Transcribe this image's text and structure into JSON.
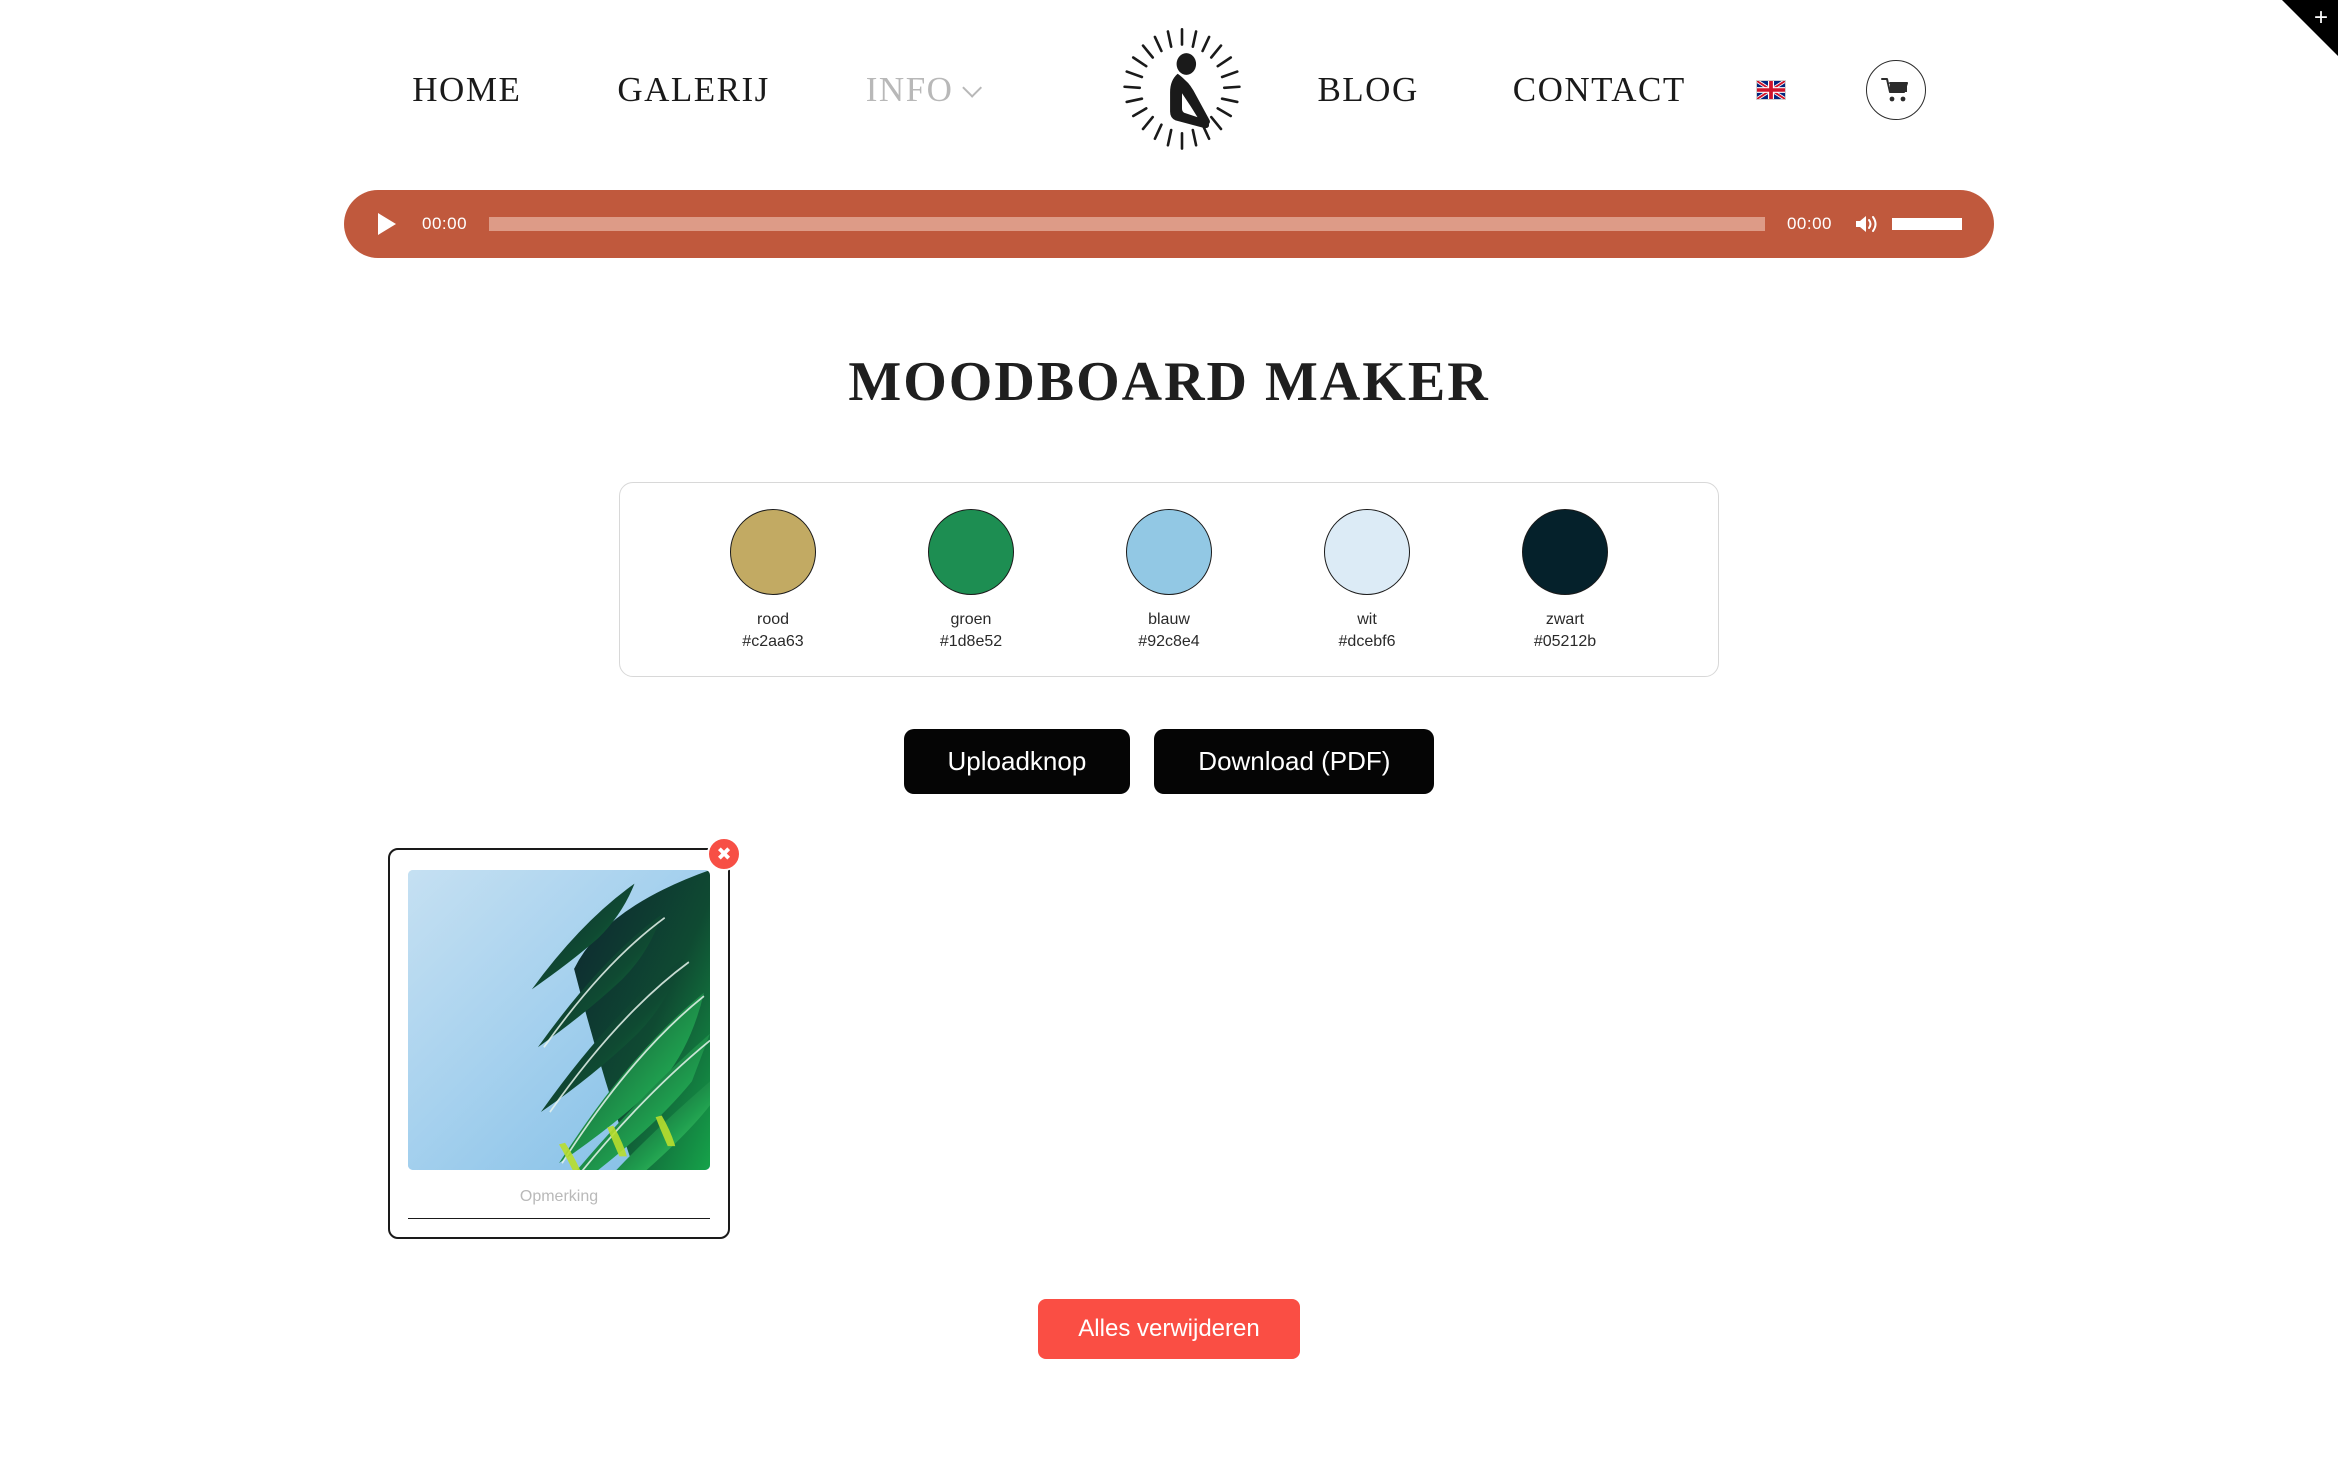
{
  "header": {
    "nav": [
      {
        "label": "HOME",
        "state": "normal"
      },
      {
        "label": "GALERIJ",
        "state": "normal"
      },
      {
        "label": "INFO",
        "state": "muted",
        "has_dropdown": true
      },
      {
        "label": "BLOG",
        "state": "normal"
      },
      {
        "label": "CONTACT",
        "state": "normal"
      }
    ],
    "logo_name": "seated-figure-sunburst-logo",
    "language_flag": "uk-flag-icon",
    "cart_icon": "shopping-cart-icon",
    "corner_ribbon_icon": "plus-icon"
  },
  "audio_player": {
    "play_icon": "play-icon",
    "current_time": "00:00",
    "duration": "00:00",
    "volume_icon": "volume-high-icon",
    "progress_percent": 0,
    "volume_percent": 100,
    "bar_color": "#c0593d",
    "track_color": "#dd9b87"
  },
  "main": {
    "title": "MOODBOARD MAKER",
    "palette": [
      {
        "name": "rood",
        "hex": "#c2aa63"
      },
      {
        "name": "groen",
        "hex": "#1d8e52"
      },
      {
        "name": "blauw",
        "hex": "#92c8e4"
      },
      {
        "name": "wit",
        "hex": "#dcebf6"
      },
      {
        "name": "zwart",
        "hex": "#05212b"
      }
    ],
    "actions": {
      "upload_label": "Uploadknop",
      "download_label": "Download (PDF)"
    },
    "cards": [
      {
        "image_alt": "palm-frond-against-blue-sky",
        "note_placeholder": "Opmerking",
        "note_value": "",
        "delete_icon": "close-icon"
      }
    ],
    "clear_all_label": "Alles verwijderen",
    "clear_all_color": "#fa4e44"
  }
}
